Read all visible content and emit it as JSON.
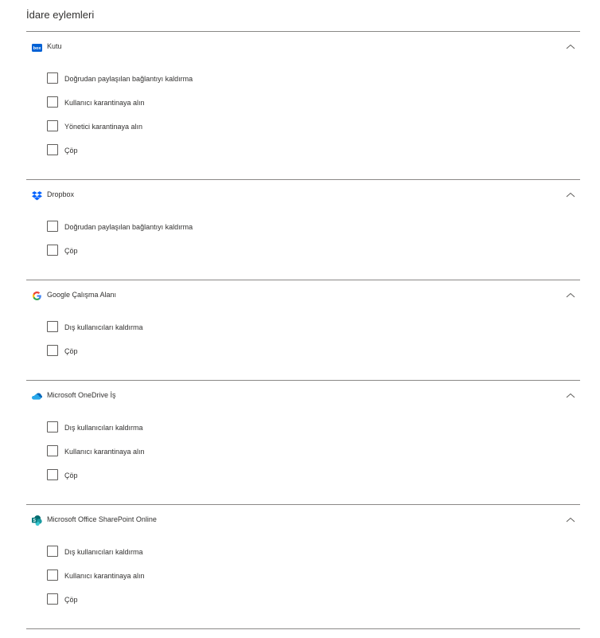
{
  "page_title": "İdare eylemleri",
  "sections": [
    {
      "name": "Kutu",
      "icon": "box-icon",
      "options": [
        "Doğrudan paylaşılan bağlantıyı kaldırma",
        "Kullanıcı karantinaya alın",
        "Yönetici karantinaya alın",
        "Çöp"
      ]
    },
    {
      "name": "Dropbox",
      "icon": "dropbox-icon",
      "options": [
        "Doğrudan paylaşılan bağlantıyı kaldırma",
        "Çöp"
      ]
    },
    {
      "name": "Google Çalışma Alanı",
      "icon": "google-icon",
      "options": [
        "Dış kullanıcıları kaldırma",
        "Çöp"
      ]
    },
    {
      "name": "Microsoft OneDrive İş",
      "icon": "onedrive-icon",
      "options": [
        "Dış kullanıcıları kaldırma",
        "Kullanıcı karantinaya alın",
        "Çöp"
      ]
    },
    {
      "name": "Microsoft Office SharePoint Online",
      "icon": "sharepoint-icon",
      "options": [
        "Dış kullanıcıları kaldırma",
        "Kullanıcı karantinaya alın",
        "Çöp"
      ]
    }
  ],
  "colors": {
    "box": "#0061d5",
    "dropbox": "#0061ff",
    "onedrive": "#0364b8",
    "sharepoint": "#038387"
  }
}
